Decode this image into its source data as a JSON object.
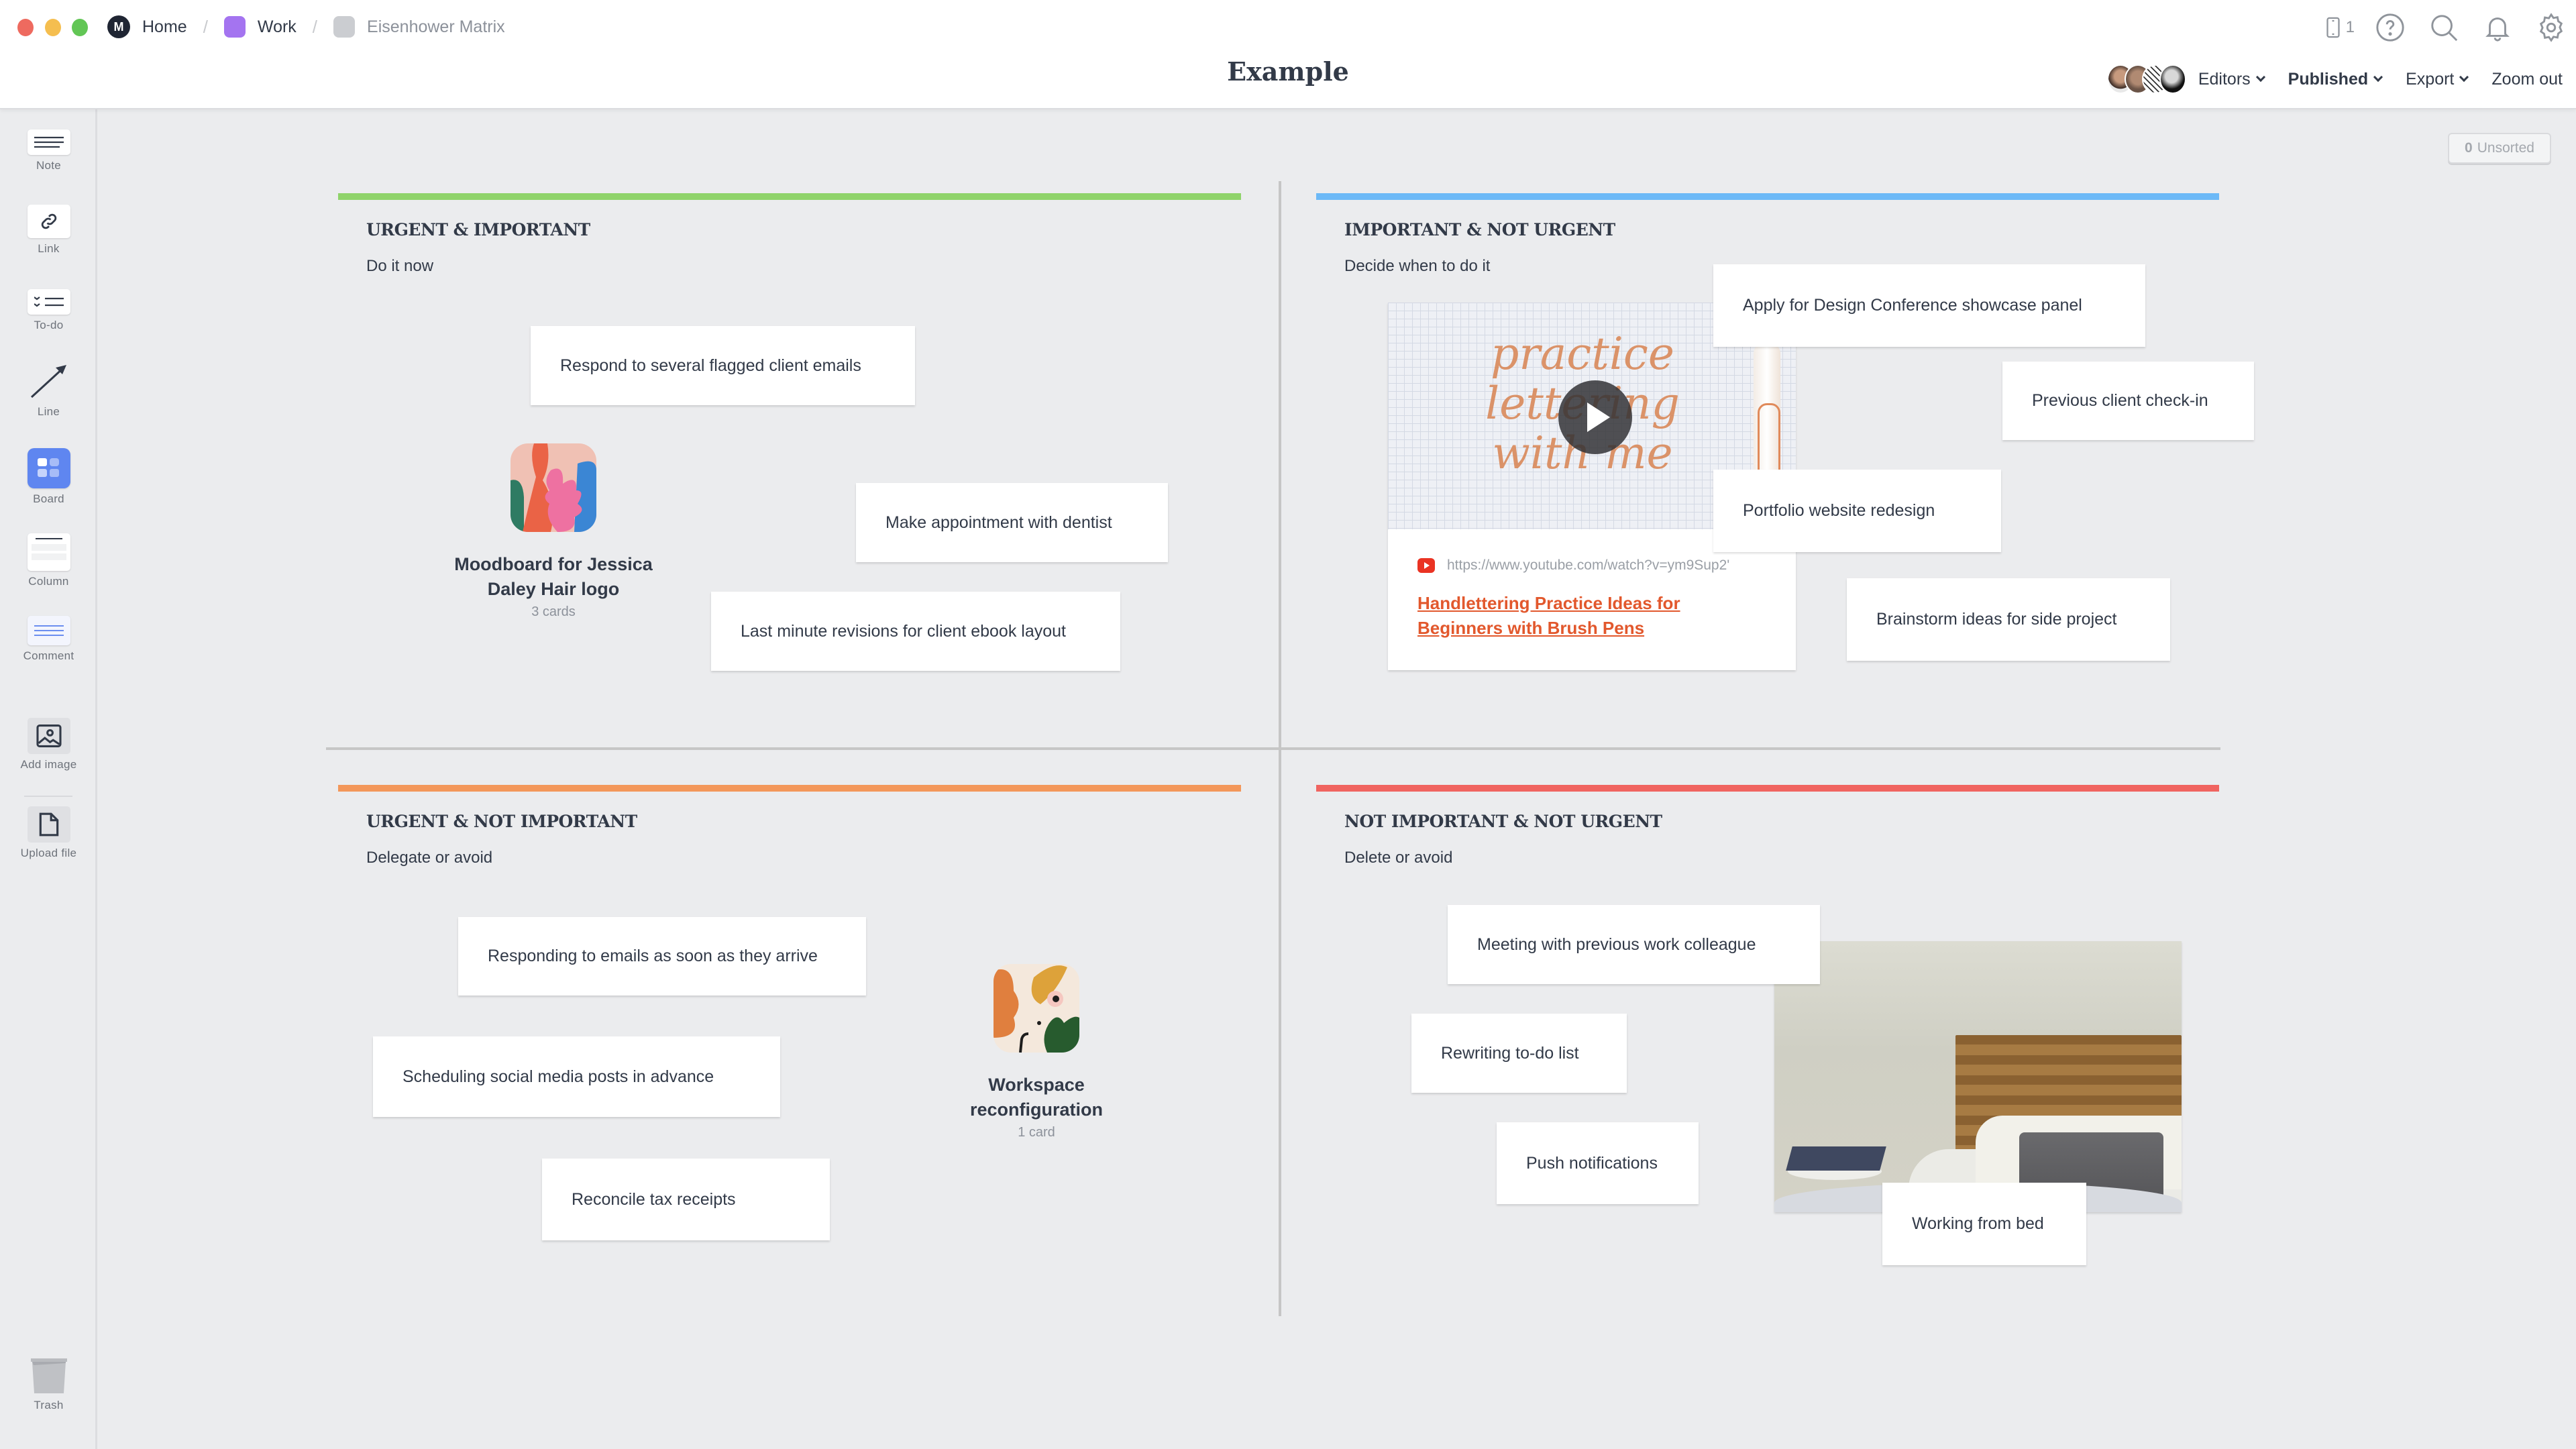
{
  "window": {
    "breadcrumbs": [
      {
        "label": "Home",
        "icon": "milanote-logo-icon"
      },
      {
        "label": "Work",
        "icon": "board-color-icon",
        "color": "#a474f0"
      },
      {
        "label": "Eisenhower Matrix",
        "icon": "board-color-icon",
        "color": "#cbcdd1"
      }
    ],
    "title": "Example",
    "device_count": "1",
    "toolbar": {
      "editors_label": "Editors",
      "published_label": "Published",
      "export_label": "Export",
      "zoom_out_label": "Zoom out"
    }
  },
  "sidebar": {
    "tools": [
      {
        "label": "Note",
        "icon": "note-icon"
      },
      {
        "label": "Link",
        "icon": "link-icon"
      },
      {
        "label": "To-do",
        "icon": "todo-icon"
      },
      {
        "label": "Line",
        "icon": "line-arrow-icon"
      },
      {
        "label": "Board",
        "icon": "board-icon"
      },
      {
        "label": "Column",
        "icon": "column-icon"
      },
      {
        "label": "Comment",
        "icon": "comment-icon"
      },
      {
        "label": "Add image",
        "icon": "image-icon"
      },
      {
        "label": "Upload file",
        "icon": "file-icon"
      }
    ],
    "trash_label": "Trash"
  },
  "unsorted": {
    "count": "0",
    "label": "Unsorted"
  },
  "quadrants": [
    {
      "title": "URGENT & IMPORTANT",
      "subtitle": "Do it now",
      "color": "#8fd36a",
      "cards": [
        "Respond to several flagged client emails",
        "Make appointment with dentist",
        "Last minute revisions for client ebook layout"
      ],
      "board": {
        "title": "Moodboard for Jessica Daley Hair logo",
        "count": "3 cards"
      }
    },
    {
      "title": "IMPORTANT & NOT URGENT",
      "subtitle": "Decide when to do it",
      "color": "#6cb9f7",
      "cards": [
        "Apply for Design Conference showcase panel",
        "Previous client check-in",
        "Portfolio website redesign",
        "Brainstorm ideas for side project"
      ],
      "video": {
        "thumbnail_text": "practice lettering with me",
        "url": "https://www.youtube.com/watch?v=ym9Sup2'",
        "title": "Handlettering Practice Ideas for Beginners with Brush Pens"
      }
    },
    {
      "title": "URGENT & NOT IMPORTANT",
      "subtitle": "Delegate or avoid",
      "color": "#f3975a",
      "cards": [
        "Responding to emails as soon as they arrive",
        "Scheduling social media posts in advance",
        "Reconcile tax receipts"
      ],
      "board": {
        "title": "Workspace reconfiguration",
        "count": "1 card"
      }
    },
    {
      "title": "NOT IMPORTANT & NOT URGENT",
      "subtitle": "Delete or avoid",
      "color": "#f06460",
      "cards": [
        "Meeting with previous work colleague",
        "Rewriting to-do list",
        "Push notifications",
        "Working from bed"
      ],
      "image": {
        "description": "laptop on bed photo"
      }
    }
  ]
}
